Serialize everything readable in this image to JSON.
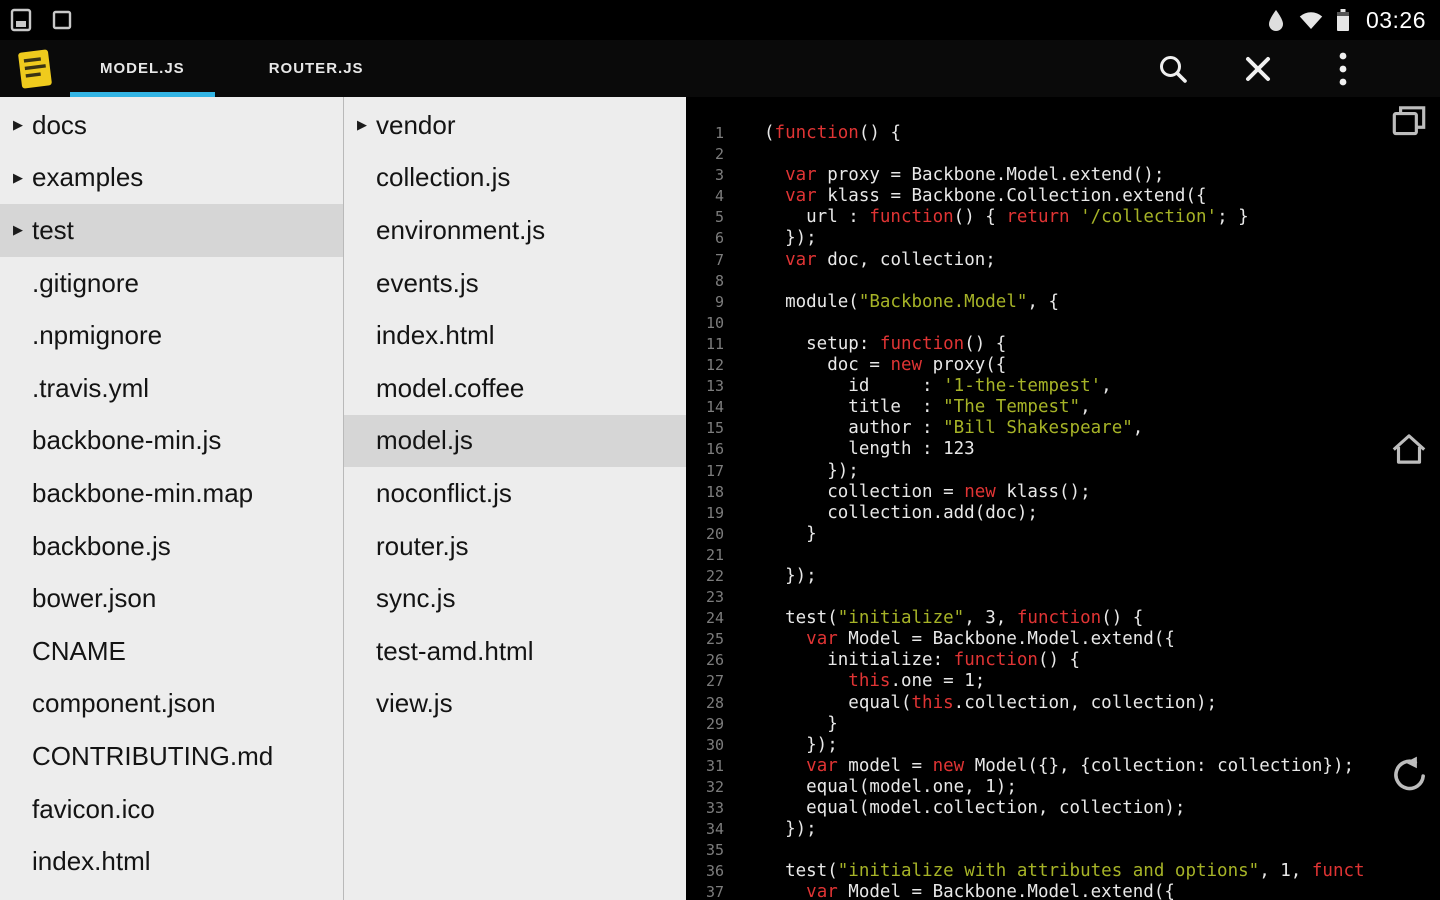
{
  "status_bar": {
    "time": "03:26",
    "icons_left": [
      "screenshot-icon",
      "display-icon"
    ],
    "icons_right": [
      "drop-notification-icon",
      "wifi-icon",
      "battery-icon"
    ]
  },
  "app_bar": {
    "accent_color": "#33B5E5",
    "tabs": [
      {
        "label": "MODEL.JS",
        "active": true
      },
      {
        "label": "ROUTER.JS",
        "active": false
      }
    ],
    "actions": [
      "search-icon",
      "close-icon",
      "overflow-menu-icon"
    ]
  },
  "file_tree": {
    "items": [
      {
        "label": "docs",
        "folder": true
      },
      {
        "label": "examples",
        "folder": true
      },
      {
        "label": "test",
        "folder": true,
        "selected": true
      },
      {
        "label": ".gitignore"
      },
      {
        "label": ".npmignore"
      },
      {
        "label": ".travis.yml"
      },
      {
        "label": "backbone-min.js"
      },
      {
        "label": "backbone-min.map"
      },
      {
        "label": "backbone.js"
      },
      {
        "label": "bower.json"
      },
      {
        "label": "CNAME"
      },
      {
        "label": "component.json"
      },
      {
        "label": "CONTRIBUTING.md"
      },
      {
        "label": "favicon.ico"
      },
      {
        "label": "index.html"
      }
    ]
  },
  "file_list": {
    "items": [
      {
        "label": "vendor",
        "folder": true
      },
      {
        "label": "collection.js"
      },
      {
        "label": "environment.js"
      },
      {
        "label": "events.js"
      },
      {
        "label": "index.html"
      },
      {
        "label": "model.coffee"
      },
      {
        "label": "model.js",
        "selected": true
      },
      {
        "label": "noconflict.js"
      },
      {
        "label": "router.js"
      },
      {
        "label": "sync.js"
      },
      {
        "label": "test-amd.html"
      },
      {
        "label": "view.js"
      }
    ]
  },
  "editor": {
    "colors": {
      "keyword": "#e03434",
      "string": "#a6b327",
      "plain": "#e8e8e8",
      "line_number": "#7d7d7d",
      "background": "#000000"
    },
    "lines": [
      [
        [
          "p",
          "("
        ],
        [
          "k",
          "function"
        ],
        [
          "p",
          "() {"
        ]
      ],
      [],
      [
        [
          "p",
          "  "
        ],
        [
          "k",
          "var"
        ],
        [
          "p",
          " proxy = Backbone.Model.extend();"
        ]
      ],
      [
        [
          "p",
          "  "
        ],
        [
          "k",
          "var"
        ],
        [
          "p",
          " klass = Backbone.Collection.extend({"
        ]
      ],
      [
        [
          "p",
          "    url : "
        ],
        [
          "k",
          "function"
        ],
        [
          "p",
          "() { "
        ],
        [
          "k",
          "return"
        ],
        [
          "p",
          " "
        ],
        [
          "s",
          "'/collection'"
        ],
        [
          "p",
          "; }"
        ]
      ],
      [
        [
          "p",
          "  });"
        ]
      ],
      [
        [
          "p",
          "  "
        ],
        [
          "k",
          "var"
        ],
        [
          "p",
          " doc, collection;"
        ]
      ],
      [],
      [
        [
          "p",
          "  module("
        ],
        [
          "s",
          "\"Backbone.Model\""
        ],
        [
          "p",
          ", {"
        ]
      ],
      [],
      [
        [
          "p",
          "    setup: "
        ],
        [
          "k",
          "function"
        ],
        [
          "p",
          "() {"
        ]
      ],
      [
        [
          "p",
          "      doc = "
        ],
        [
          "k",
          "new"
        ],
        [
          "p",
          " proxy({"
        ]
      ],
      [
        [
          "p",
          "        id     : "
        ],
        [
          "s",
          "'1-the-tempest'"
        ],
        [
          "p",
          ","
        ]
      ],
      [
        [
          "p",
          "        title  : "
        ],
        [
          "s",
          "\"The Tempest\""
        ],
        [
          "p",
          ","
        ]
      ],
      [
        [
          "p",
          "        author : "
        ],
        [
          "s",
          "\"Bill Shakespeare\""
        ],
        [
          "p",
          ","
        ]
      ],
      [
        [
          "p",
          "        length : 123"
        ]
      ],
      [
        [
          "p",
          "      });"
        ]
      ],
      [
        [
          "p",
          "      collection = "
        ],
        [
          "k",
          "new"
        ],
        [
          "p",
          " klass();"
        ]
      ],
      [
        [
          "p",
          "      collection.add(doc);"
        ]
      ],
      [
        [
          "p",
          "    }"
        ]
      ],
      [],
      [
        [
          "p",
          "  });"
        ]
      ],
      [],
      [
        [
          "p",
          "  test("
        ],
        [
          "s",
          "\"initialize\""
        ],
        [
          "p",
          ", 3, "
        ],
        [
          "k",
          "function"
        ],
        [
          "p",
          "() {"
        ]
      ],
      [
        [
          "p",
          "    "
        ],
        [
          "k",
          "var"
        ],
        [
          "p",
          " Model = Backbone.Model.extend({"
        ]
      ],
      [
        [
          "p",
          "      initialize: "
        ],
        [
          "k",
          "function"
        ],
        [
          "p",
          "() {"
        ]
      ],
      [
        [
          "p",
          "        "
        ],
        [
          "k",
          "this"
        ],
        [
          "p",
          ".one = 1;"
        ]
      ],
      [
        [
          "p",
          "        equal("
        ],
        [
          "k",
          "this"
        ],
        [
          "p",
          ".collection, collection);"
        ]
      ],
      [
        [
          "p",
          "      }"
        ]
      ],
      [
        [
          "p",
          "    });"
        ]
      ],
      [
        [
          "p",
          "    "
        ],
        [
          "k",
          "var"
        ],
        [
          "p",
          " model = "
        ],
        [
          "k",
          "new"
        ],
        [
          "p",
          " Model({}, {collection: collection});"
        ]
      ],
      [
        [
          "p",
          "    equal(model.one, 1);"
        ]
      ],
      [
        [
          "p",
          "    equal(model.collection, collection);"
        ]
      ],
      [
        [
          "p",
          "  });"
        ]
      ],
      [],
      [
        [
          "p",
          "  test("
        ],
        [
          "s",
          "\"initialize with attributes and options\""
        ],
        [
          "p",
          ", 1, "
        ],
        [
          "k",
          "funct"
        ]
      ],
      [
        [
          "p",
          "    "
        ],
        [
          "k",
          "var"
        ],
        [
          "p",
          " Model = Backbone.Model.extend({"
        ]
      ]
    ]
  },
  "nav_bar": {
    "icons": [
      "recents-icon",
      "home-icon",
      "back-icon"
    ]
  }
}
